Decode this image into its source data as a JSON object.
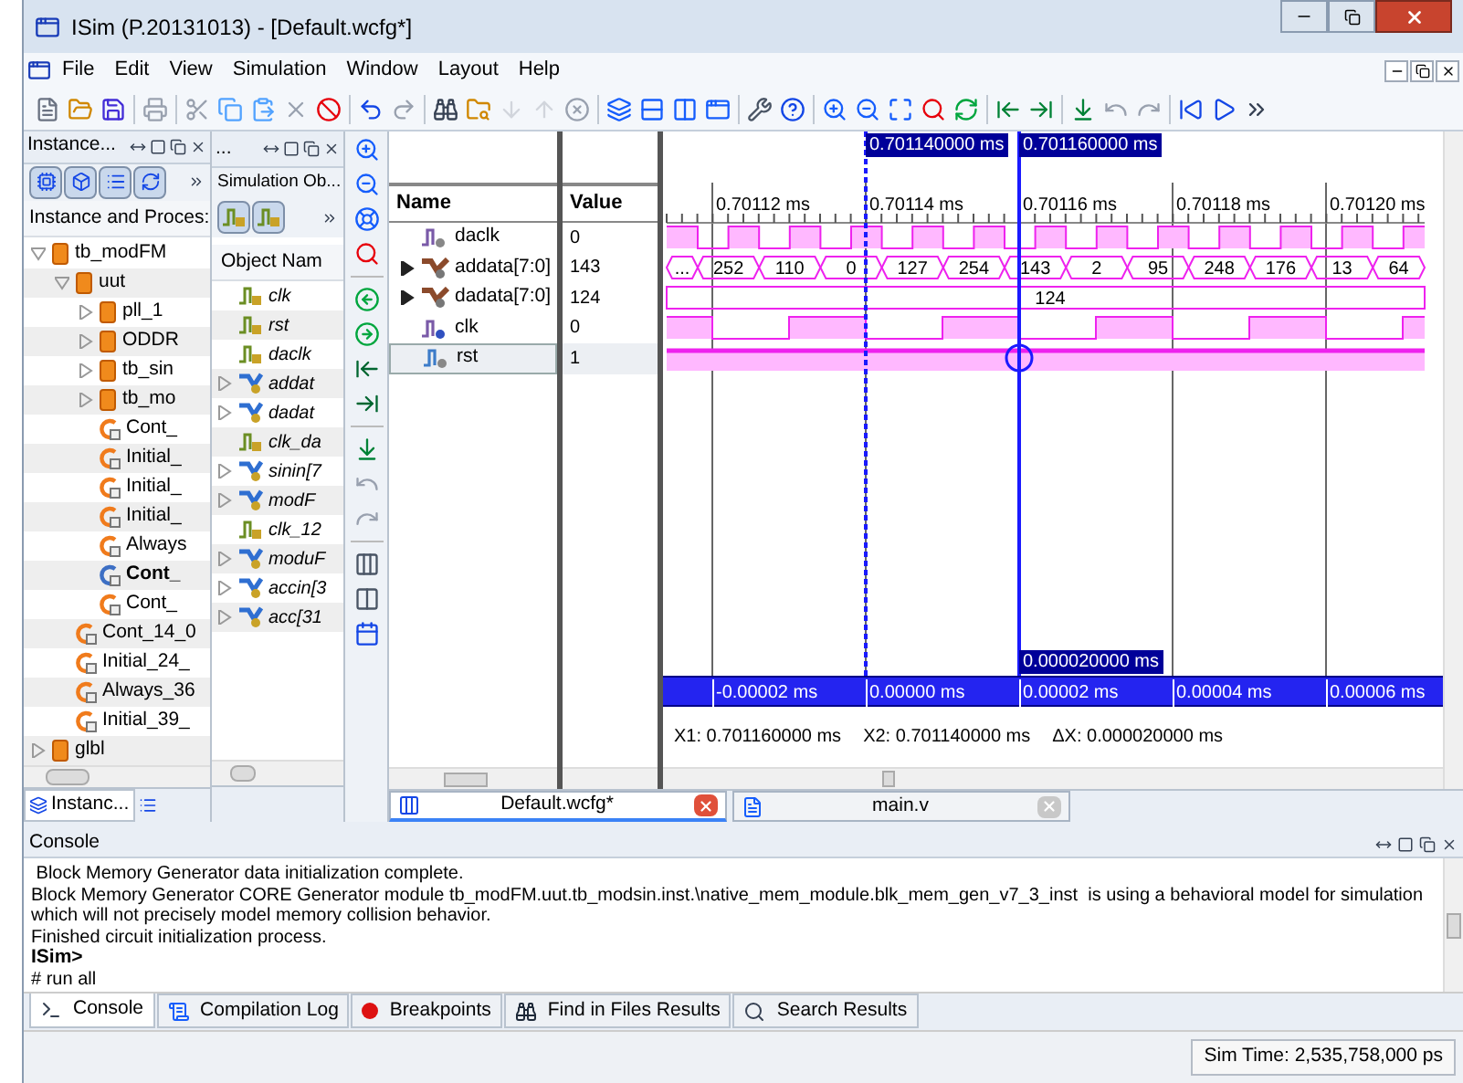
{
  "window": {
    "title": "ISim (P.20131013) - [Default.wcfg*]"
  },
  "menu": [
    "File",
    "Edit",
    "View",
    "Simulation",
    "Window",
    "Layout",
    "Help"
  ],
  "instances_panel": {
    "title": "Instance...",
    "column": "Instance and Proces:",
    "tab": "Instanc...",
    "tree": [
      {
        "label": "tb_modFM",
        "kind": "module",
        "expanded": true,
        "selected": false,
        "children": [
          {
            "label": "uut",
            "kind": "module",
            "expanded": true,
            "selected": false,
            "children": [
              {
                "label": "pll_1",
                "kind": "module",
                "expanded": false,
                "selected": false
              },
              {
                "label": "ODDR",
                "kind": "module",
                "expanded": false,
                "selected": false
              },
              {
                "label": "tb_sin",
                "kind": "module",
                "expanded": false,
                "selected": false
              },
              {
                "label": "tb_mo",
                "kind": "module",
                "expanded": false,
                "selected": false
              },
              {
                "label": "Cont_",
                "kind": "process",
                "selected": false
              },
              {
                "label": "Initial_",
                "kind": "process",
                "selected": false
              },
              {
                "label": "Initial_",
                "kind": "process",
                "selected": false
              },
              {
                "label": "Initial_",
                "kind": "process",
                "selected": false
              },
              {
                "label": "Always",
                "kind": "process",
                "selected": false
              },
              {
                "label": "Cont_",
                "kind": "process",
                "selected": true
              },
              {
                "label": "Cont_",
                "kind": "process",
                "selected": false
              }
            ]
          },
          {
            "label": "Cont_14_0",
            "kind": "process",
            "selected": false
          },
          {
            "label": "Initial_24_",
            "kind": "process",
            "selected": false
          },
          {
            "label": "Always_36",
            "kind": "process",
            "selected": false
          },
          {
            "label": "Initial_39_",
            "kind": "process",
            "selected": false
          }
        ]
      },
      {
        "label": "glbl",
        "kind": "module",
        "expanded": false,
        "selected": false
      }
    ]
  },
  "objects_panel": {
    "title": "...",
    "subtitle": "Simulation Ob...",
    "column": "Object Nam",
    "items": [
      {
        "label": "clk",
        "kind": "bit",
        "expandable": false
      },
      {
        "label": "rst",
        "kind": "bit",
        "expandable": false
      },
      {
        "label": "daclk",
        "kind": "bit",
        "expandable": false
      },
      {
        "label": "addat",
        "kind": "bus",
        "expandable": true
      },
      {
        "label": "dadat",
        "kind": "bus",
        "expandable": true
      },
      {
        "label": "clk_da",
        "kind": "bit",
        "expandable": false
      },
      {
        "label": "sinin[7",
        "kind": "bus",
        "expandable": true
      },
      {
        "label": "modF",
        "kind": "bus",
        "expandable": true
      },
      {
        "label": "clk_12",
        "kind": "bit",
        "expandable": false
      },
      {
        "label": "moduF",
        "kind": "bus",
        "expandable": true
      },
      {
        "label": "accin[3",
        "kind": "bus",
        "expandable": true
      },
      {
        "label": "acc[31",
        "kind": "bus",
        "expandable": true
      }
    ]
  },
  "wave": {
    "columns": [
      "Name",
      "Value"
    ],
    "cursors": [
      {
        "label": "0.701140000 ms",
        "kind": "secondary"
      },
      {
        "label": "0.701160000 ms",
        "kind": "main"
      }
    ],
    "time_labels": [
      "0.70112 ms",
      "0.70114 ms",
      "0.70116 ms",
      "0.70118 ms",
      "0.70120 ms"
    ],
    "signals": [
      {
        "name": "daclk",
        "value": "0",
        "kind": "fastclock",
        "expandable": false,
        "selected": false
      },
      {
        "name": "addata[7:0]",
        "value": "143",
        "kind": "bus",
        "expandable": true,
        "selected": false,
        "segments": [
          "...",
          "252",
          "110",
          "0",
          "127",
          "254",
          "143",
          "2",
          "95",
          "248",
          "176",
          "13",
          "64"
        ]
      },
      {
        "name": "dadata[7:0]",
        "value": "124",
        "kind": "bus",
        "expandable": true,
        "selected": false,
        "segments": [
          "124"
        ]
      },
      {
        "name": "clk",
        "value": "0",
        "kind": "clock",
        "expandable": false,
        "selected": false
      },
      {
        "name": "rst",
        "value": "1",
        "kind": "bit",
        "expandable": false,
        "selected": true
      }
    ],
    "delta_label": "0.000020000 ms",
    "ruler_labels": [
      "-0.00002 ms",
      "0.00000 ms",
      "0.00002 ms",
      "0.00004 ms",
      "0.00006 ms"
    ],
    "readout": [
      "X1: 0.701160000 ms",
      "X2: 0.701140000 ms",
      "ΔX: 0.000020000 ms"
    ]
  },
  "doc_tabs": [
    {
      "label": "Default.wcfg*",
      "kind": "wave",
      "selected": true
    },
    {
      "label": "main.v",
      "kind": "source",
      "selected": false
    }
  ],
  "console": {
    "title": "Console",
    "lines": [
      {
        "text": " Block Memory Generator data initialization complete.",
        "kind": "output"
      },
      {
        "text": "Block Memory Generator CORE Generator module tb_modFM.uut.tb_modsin.inst.\\native_mem_module.blk_mem_gen_v7_3_inst  is using a behavioral model for simulation which will not precisely model memory collision behavior.",
        "kind": "output"
      },
      {
        "text": "Finished circuit initialization process.",
        "kind": "output"
      },
      {
        "text": "ISim>",
        "kind": "prompt"
      },
      {
        "text": "# run all",
        "kind": "output"
      }
    ]
  },
  "bottom_tabs": [
    {
      "label": "Console",
      "kind": "console",
      "selected": true
    },
    {
      "label": "Compilation Log",
      "kind": "log",
      "selected": false
    },
    {
      "label": "Breakpoints",
      "kind": "breakpoint",
      "selected": false
    },
    {
      "label": "Find in Files Results",
      "kind": "find",
      "selected": false
    },
    {
      "label": "Search Results",
      "kind": "search",
      "selected": false
    }
  ],
  "status": "Sim Time: 2,535,758,000 ps"
}
